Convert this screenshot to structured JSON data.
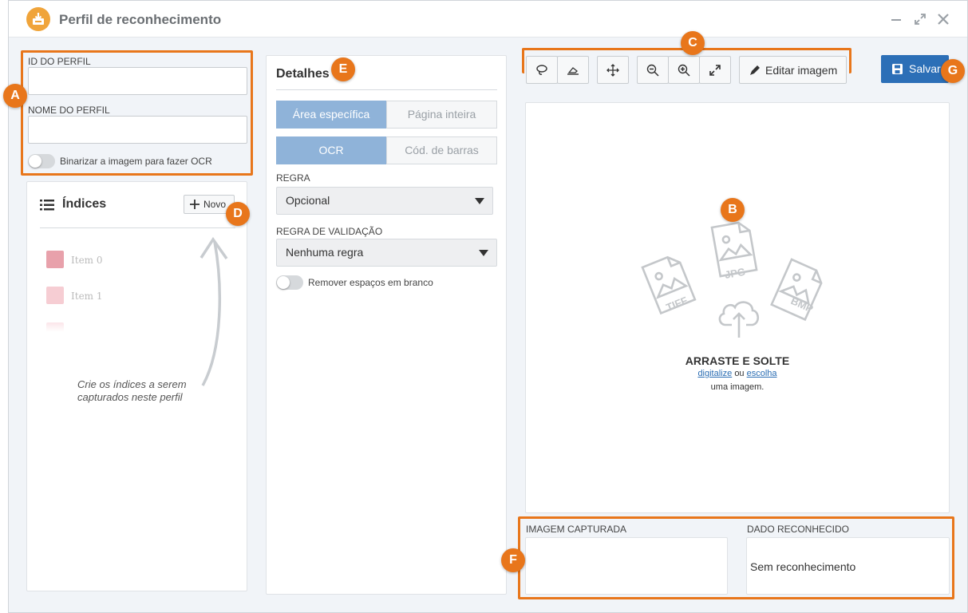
{
  "window": {
    "title": "Perfil de reconhecimento",
    "minimize_icon": "minimize-icon",
    "maximize_icon": "maximize-icon",
    "close_icon": "close-icon",
    "app_icon": "inbox-download-icon"
  },
  "profile": {
    "id_label": "ID DO PERFIL",
    "id_value": "",
    "name_label": "NOME DO PERFIL",
    "name_value": "",
    "binarize_label": "Binarizar a imagem para fazer OCR",
    "binarize_on": false
  },
  "indices": {
    "title": "Índices",
    "new_button": "Novo",
    "items": [
      {
        "label": "Item 0",
        "color": "#e8a1ab"
      },
      {
        "label": "Item 1",
        "color": "#f6cdd3"
      }
    ],
    "hint": "Crie os índices a serem capturados neste perfil"
  },
  "details": {
    "title": "Detalhes",
    "area_tabs": [
      {
        "label": "Área específica",
        "active": true
      },
      {
        "label": "Página inteira",
        "active": false
      }
    ],
    "mode_tabs": [
      {
        "label": "OCR",
        "active": true
      },
      {
        "label": "Cód. de barras",
        "active": false
      }
    ],
    "rule_label": "REGRA",
    "rule_value": "Opcional",
    "validation_label": "REGRA DE VALIDAÇÃO",
    "validation_value": "Nenhuma regra",
    "remove_spaces_label": "Remover espaços em branco",
    "remove_spaces_on": false
  },
  "toolbar": {
    "lasso_icon": "lasso-icon",
    "eraser_icon": "eraser-icon",
    "move_icon": "move-icon",
    "zoom_out_icon": "zoom-out-icon",
    "zoom_in_icon": "zoom-in-icon",
    "fit_icon": "expand-icon",
    "edit_label": "Editar imagem",
    "save_label": "Salvar"
  },
  "dropzone": {
    "title": "ARRASTE E SOLTE",
    "link_scan": "digitalize",
    "or": "ou",
    "link_choose": "escolha",
    "suffix": "uma imagem.",
    "file_types": [
      "TIFF",
      "JPG",
      "BMP"
    ]
  },
  "capture": {
    "image_label": "IMAGEM CAPTURADA",
    "data_label": "DADO RECONHECIDO",
    "data_value": "Sem reconhecimento"
  },
  "callouts": [
    "A",
    "B",
    "C",
    "D",
    "E",
    "F",
    "G"
  ],
  "colors": {
    "accent_orange": "#e8761b",
    "primary_blue": "#2c6fb7",
    "tab_active": "#8fb3d9"
  }
}
